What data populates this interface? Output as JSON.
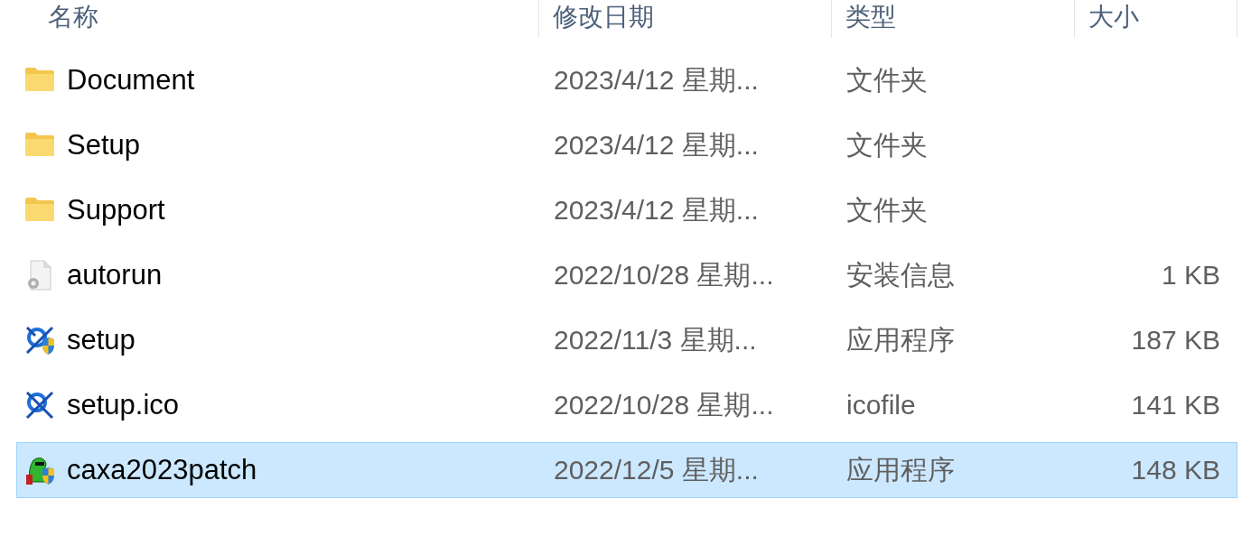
{
  "columns": [
    {
      "label": "名称"
    },
    {
      "label": "修改日期"
    },
    {
      "label": "类型"
    },
    {
      "label": "大小"
    }
  ],
  "rows": [
    {
      "kind": "folder",
      "name": "Document",
      "date": "2023/4/12 星期...",
      "type": "文件夹",
      "selected": false
    },
    {
      "kind": "folder",
      "name": "Setup",
      "date": "2023/4/12 星期...",
      "type": "文件夹",
      "selected": false
    },
    {
      "kind": "folder",
      "name": "Support",
      "date": "2023/4/12 星期...",
      "type": "文件夹",
      "selected": false
    },
    {
      "kind": "settings",
      "name": "autorun",
      "date": "2022/10/28 星期...",
      "type": "安装信息",
      "size": "1 KB",
      "selected": false
    },
    {
      "kind": "installer",
      "name": "setup",
      "date": "2022/11/3 星期...",
      "type": "应用程序",
      "size": "187 KB",
      "selected": false
    },
    {
      "kind": "app-icon",
      "name": "setup.ico",
      "date": "2022/10/28 星期...",
      "type": "icofile",
      "size": "141 KB",
      "selected": false
    },
    {
      "kind": "patch",
      "name": "caxa2023patch",
      "date": "2022/12/5 星期...",
      "type": "应用程序",
      "size": "148 KB",
      "selected": true
    }
  ]
}
